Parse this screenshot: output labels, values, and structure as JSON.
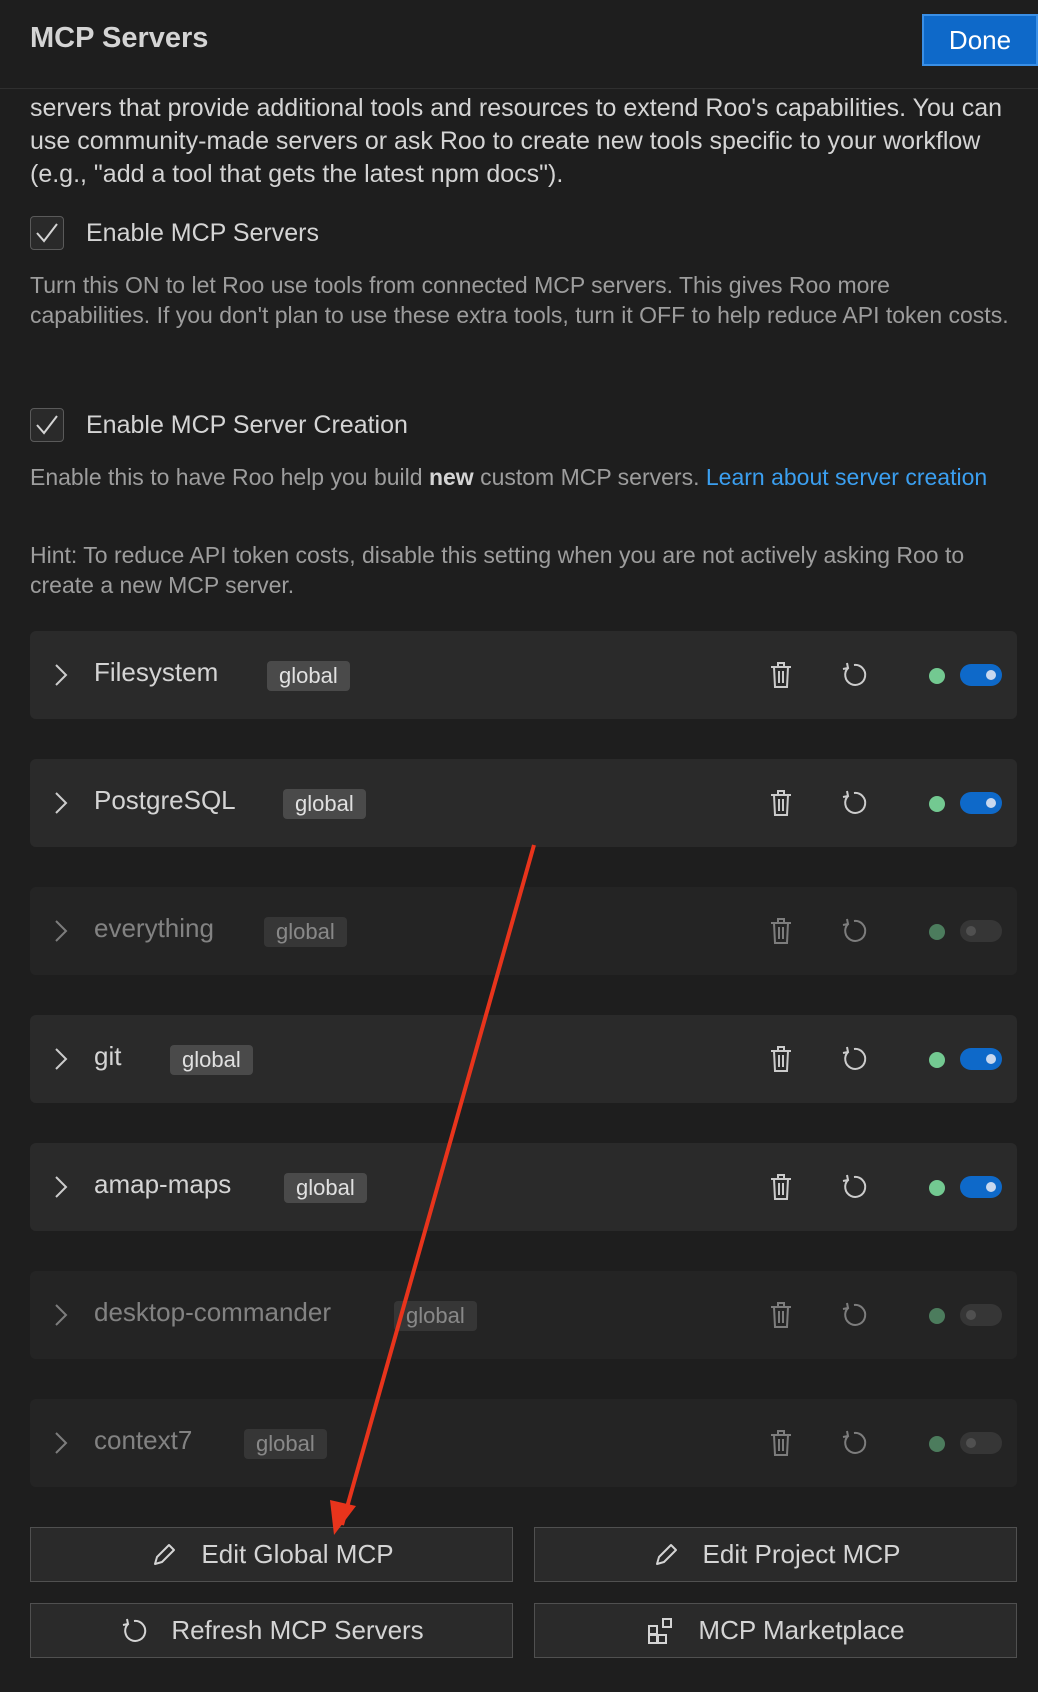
{
  "header": {
    "title": "MCP Servers",
    "done_label": "Done"
  },
  "intro": "servers that provide additional tools and resources to extend Roo's capabilities. You can use community-made servers or ask Roo to create new tools specific to your workflow (e.g., \"add a tool that gets the latest npm docs\").",
  "enable_servers": {
    "label": "Enable MCP Servers",
    "checked": true,
    "description": "Turn this ON to let Roo use tools from connected MCP servers. This gives Roo more capabilities. If you don't plan to use these extra tools, turn it OFF to help reduce API token costs."
  },
  "enable_creation": {
    "label": "Enable MCP Server Creation",
    "checked": true,
    "description_pre": "Enable this to have Roo help you build ",
    "description_bold": "new",
    "description_post": " custom MCP servers. ",
    "link_text": "Learn about server creation",
    "hint": "Hint: To reduce API token costs, disable this setting when you are not actively asking Roo to create a new MCP server."
  },
  "servers": [
    {
      "name": "Filesystem",
      "scope": "global",
      "enabled": true
    },
    {
      "name": "PostgreSQL",
      "scope": "global",
      "enabled": true
    },
    {
      "name": "everything",
      "scope": "global",
      "enabled": false
    },
    {
      "name": "git",
      "scope": "global",
      "enabled": true
    },
    {
      "name": "amap-maps",
      "scope": "global",
      "enabled": true
    },
    {
      "name": "desktop-commander",
      "scope": "global",
      "enabled": false
    },
    {
      "name": "context7",
      "scope": "global",
      "enabled": false
    }
  ],
  "actions": {
    "edit_global": "Edit Global MCP",
    "edit_project": "Edit Project MCP",
    "refresh": "Refresh MCP Servers",
    "marketplace": "MCP Marketplace"
  },
  "colors": {
    "accent": "#0e69c9",
    "link": "#3b9ff0",
    "status_ok": "#73c991",
    "annotation_arrow": "#e8341c"
  }
}
